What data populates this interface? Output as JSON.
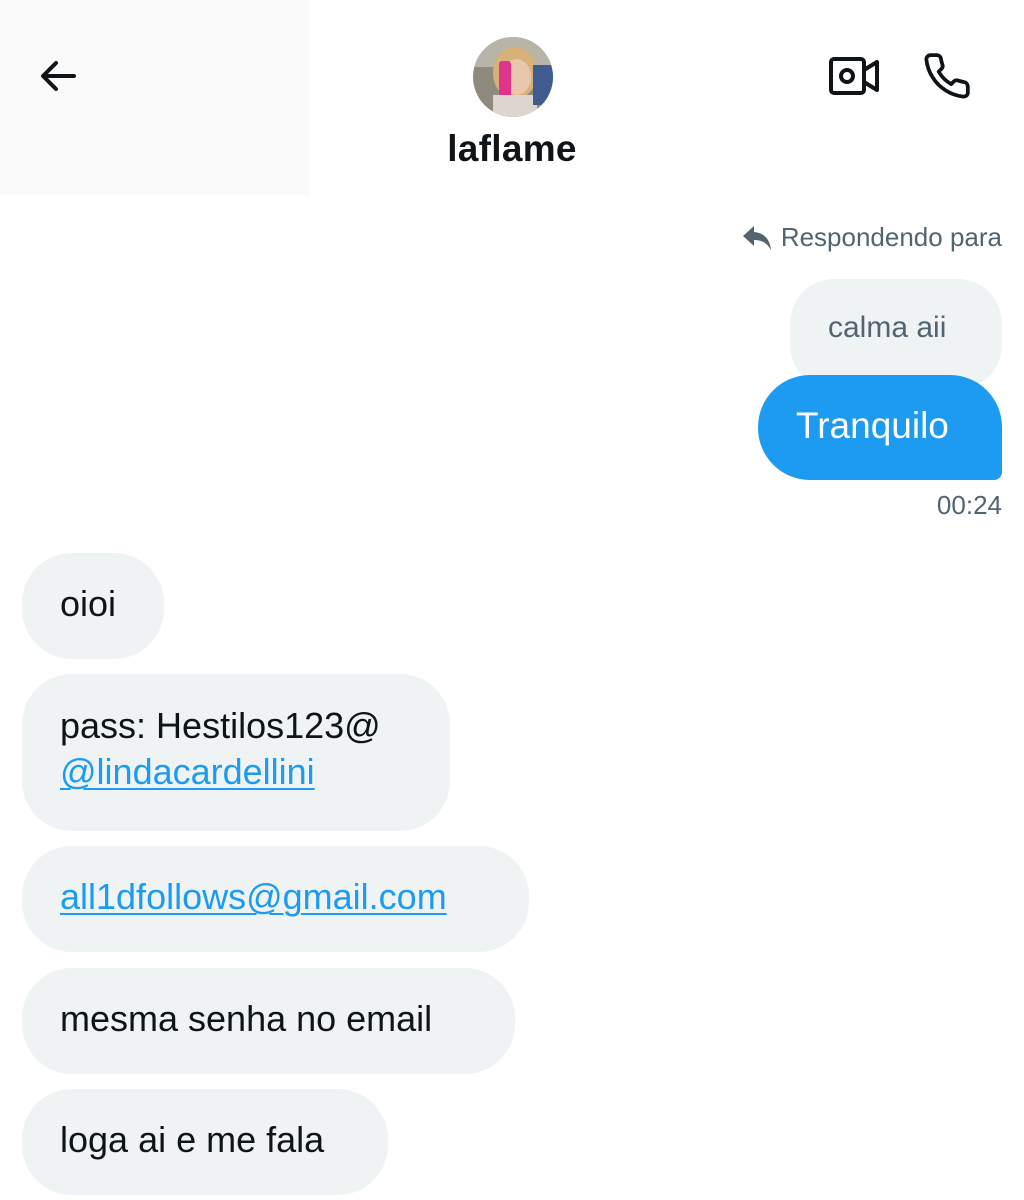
{
  "header": {
    "contact_name": "laflame",
    "icons": {
      "back": "arrow-left-icon",
      "video": "video-camera-icon",
      "call": "phone-icon"
    }
  },
  "thread": {
    "reply_indicator": "Respondendo para",
    "replied_to_message": "calma aii",
    "sent_message": "Tranquilo",
    "sent_time": "00:24",
    "received": {
      "m1": "oioi",
      "m2_line1": "pass: Hestilos123@",
      "m2_mention": "@lindacardellini",
      "m3_email": "all1dfollows@gmail.com",
      "m4": "mesma senha no email",
      "m5": "loga ai e me fala"
    }
  },
  "colors": {
    "accent": "#1d9bf0",
    "bubble_gray": "#eff3f4",
    "secondary_text": "#536471",
    "primary_text": "#0f1419"
  }
}
